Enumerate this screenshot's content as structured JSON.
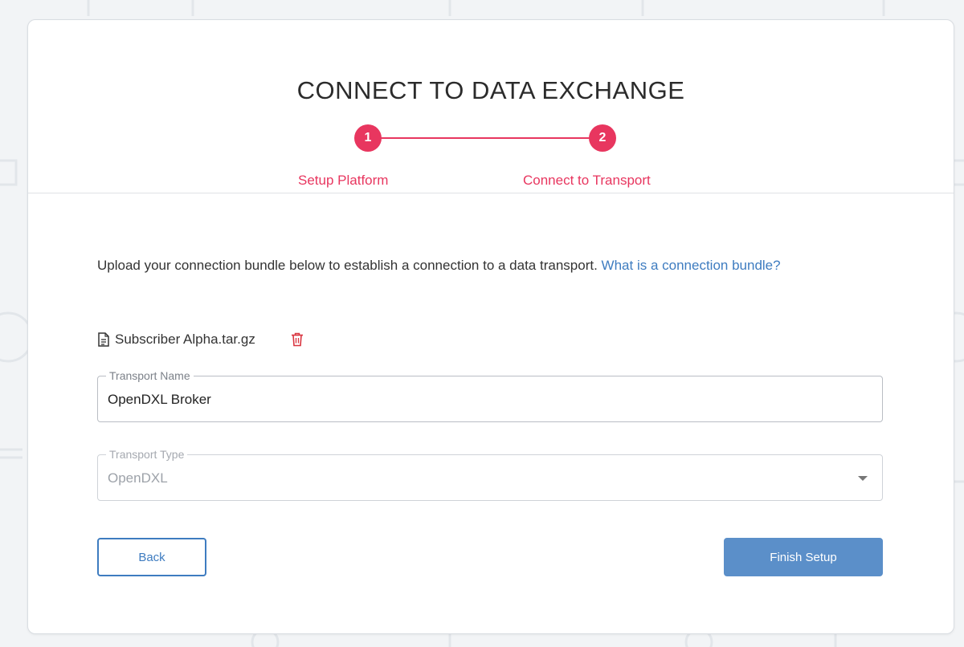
{
  "page": {
    "title": "CONNECT TO DATA EXCHANGE",
    "accent_color": "#e8365f",
    "link_color": "#3e7cc0"
  },
  "stepper": {
    "steps": [
      {
        "number": "1",
        "label": "Setup Platform"
      },
      {
        "number": "2",
        "label": "Connect to Transport"
      }
    ]
  },
  "description": {
    "text": "Upload your connection bundle below to establish a connection to a data transport.",
    "link_text": "What is a connection bundle?"
  },
  "file": {
    "name": "Subscriber Alpha.tar.gz",
    "icon": "document-icon",
    "delete_icon": "trash-icon"
  },
  "transport_name": {
    "label": "Transport Name",
    "value": "OpenDXL Broker"
  },
  "transport_type": {
    "label": "Transport Type",
    "value": "OpenDXL"
  },
  "actions": {
    "back_label": "Back",
    "finish_label": "Finish Setup"
  }
}
